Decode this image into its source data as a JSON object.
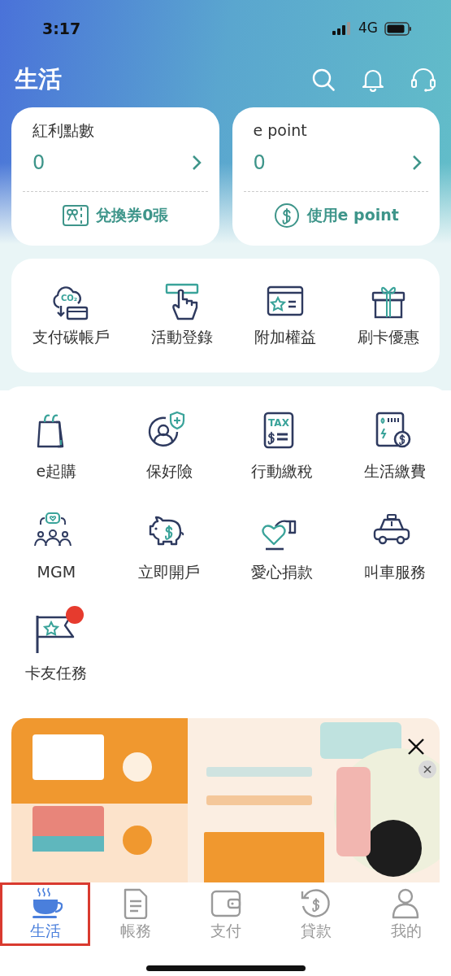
{
  "status_bar": {
    "time": "3:17",
    "network": "4G"
  },
  "header": {
    "title": "生活"
  },
  "point_cards": [
    {
      "title": "紅利點數",
      "value": "0",
      "action": "兌換券0張"
    },
    {
      "title": "e point",
      "value": "0",
      "action": "使用e point"
    }
  ],
  "quick_links": [
    {
      "label": "支付碳帳戶",
      "icon_text": "CO₂"
    },
    {
      "label": "活動登錄"
    },
    {
      "label": "附加權益"
    },
    {
      "label": "刷卡優惠"
    }
  ],
  "services": [
    {
      "label": "e起購",
      "badge": false
    },
    {
      "label": "保好險",
      "badge": false
    },
    {
      "label": "行動繳稅",
      "badge": false,
      "icon_text": "TAX"
    },
    {
      "label": "生活繳費",
      "badge": false
    },
    {
      "label": "MGM",
      "badge": false
    },
    {
      "label": "立即開戶",
      "badge": false
    },
    {
      "label": "愛心捐款",
      "badge": false
    },
    {
      "label": "叫車服務",
      "badge": false
    },
    {
      "label": "卡友任務",
      "badge": true
    }
  ],
  "tabs": [
    {
      "label": "生活",
      "selected": true,
      "highlighted": true
    },
    {
      "label": "帳務",
      "selected": false,
      "highlighted": false
    },
    {
      "label": "支付",
      "selected": false,
      "highlighted": false
    },
    {
      "label": "貸款",
      "selected": false,
      "highlighted": false
    },
    {
      "label": "我的",
      "selected": false,
      "highlighted": false
    }
  ]
}
